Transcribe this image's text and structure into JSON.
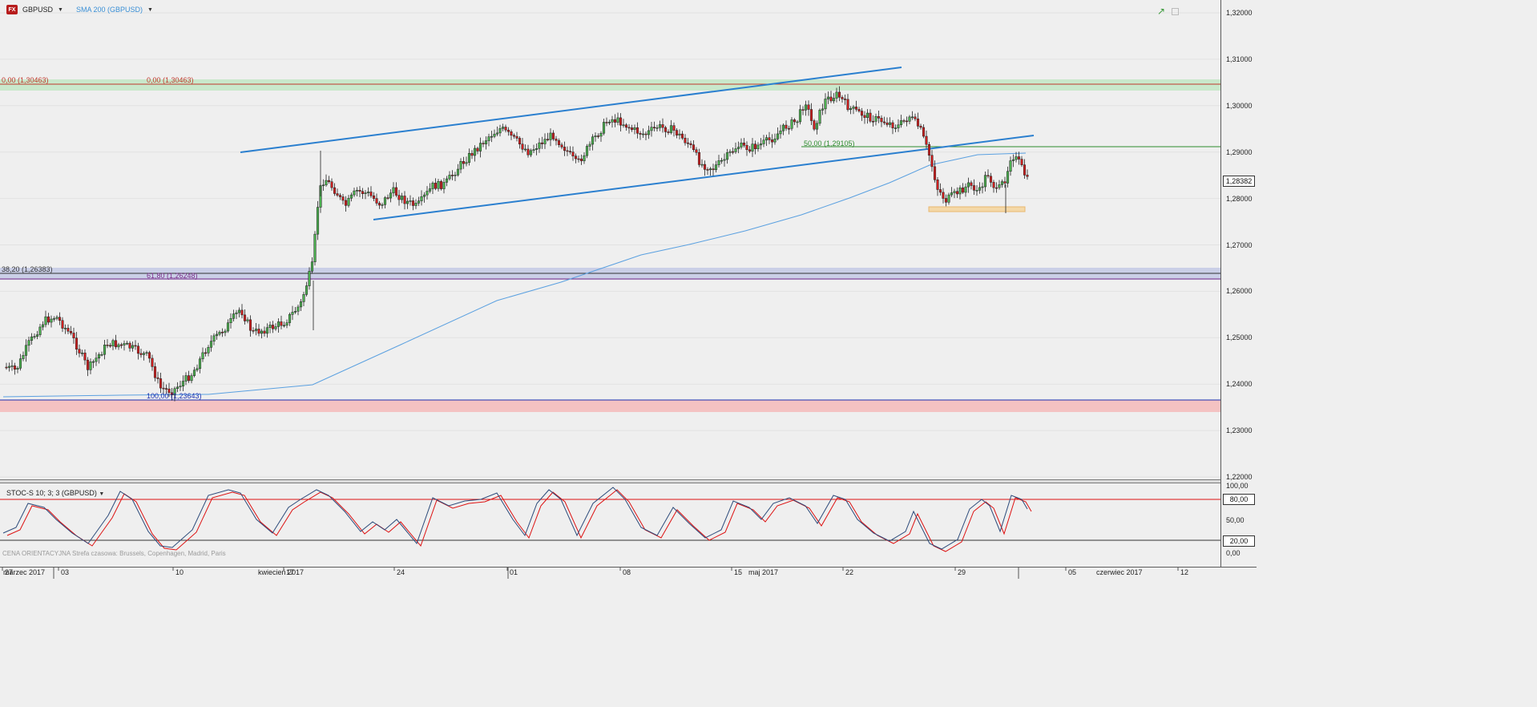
{
  "toolbar": {
    "symbol": "GBPUSD",
    "indicator": "SMA 200 (GBPUSD)",
    "stoch_indicator": "STOC-S 10; 3; 3 (GBPUSD)",
    "watermark": "CENA ORIENTACYJNA   Strefa czasowa: Brussels, Copenhagen, Madrid, Paris"
  },
  "levels": {
    "fib0_left": "0,00 (1,30463)",
    "fib0_mid": "0,00 (1,30463)",
    "fib382": "38,20 (1,26383)",
    "fib618": "61,80 (1,26248)",
    "fib100": "100,00 (1,23643)",
    "fib50": "50,00 (1,29105)"
  },
  "price_axis": {
    "ticks": [
      "1,32000",
      "1,31000",
      "1,30000",
      "1,29000",
      "1,28000",
      "1,27000",
      "1,26000",
      "1,25000",
      "1,24000",
      "1,23000",
      "1,22000"
    ],
    "current_price": "1,28382"
  },
  "stoch_axis": {
    "ticks": [
      "100,00",
      "50,00",
      "0,00"
    ],
    "upper_tag": "80,00",
    "lower_tag": "20,00"
  },
  "date_axis": {
    "ticks": [
      "27",
      "03",
      "10",
      "17",
      "24",
      "01",
      "08",
      "15",
      "22",
      "29",
      "05",
      "12"
    ],
    "months": [
      "marzec 2017",
      "kwiecień 2017",
      "maj 2017",
      "czerwiec 2017"
    ]
  },
  "colors": {
    "bull": "#4caf50",
    "bear": "#cc1f1f",
    "trend": "#2a7fcf",
    "sma": "#5aa0e0",
    "resistance_zone": "#bfe6c2",
    "fib_zone": "#c5cbe6",
    "support_zone": "#f4bcbc"
  }
}
